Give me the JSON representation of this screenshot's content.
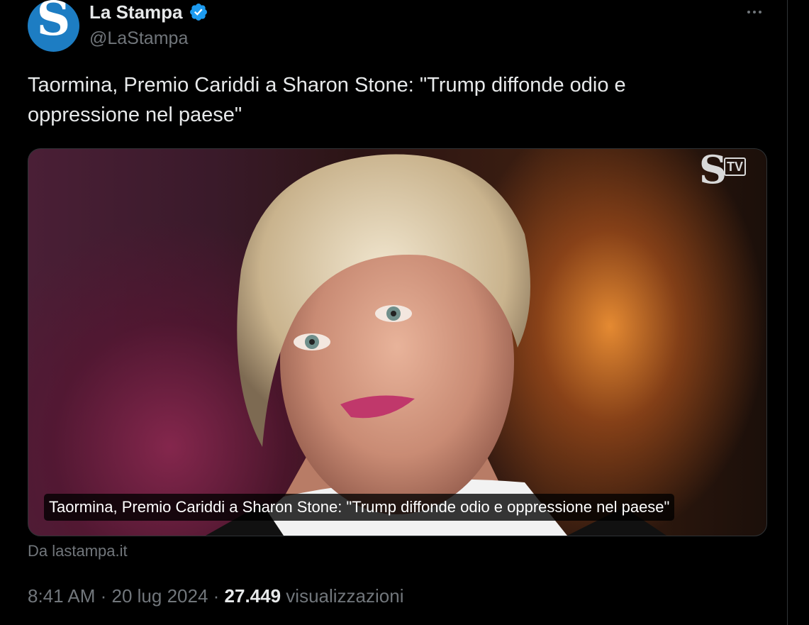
{
  "author": {
    "avatar_letter": "S",
    "display_name": "La Stampa",
    "handle": "@LaStampa",
    "verified": true,
    "verified_color": "#1d9bf0"
  },
  "tweet": {
    "text": "Taormina, Premio Cariddi a Sharon Stone: \"Trump diffonde odio e oppressione nel paese\""
  },
  "card": {
    "logo_s": "S",
    "logo_tv": "TV",
    "caption": "Taormina, Premio Cariddi a Sharon Stone: \"Trump diffonde odio e oppressione nel paese\"",
    "source": "Da lastampa.it"
  },
  "meta": {
    "time": "8:41 AM",
    "date": "20 lug 2024",
    "separator": " · ",
    "views_count": "27.449",
    "views_label": "visualizzazioni"
  },
  "colors": {
    "background": "#000000",
    "text_primary": "#e7e9ea",
    "text_secondary": "#71767b",
    "border": "#2f3336",
    "brand_blue": "#1d7dc3"
  },
  "icons": {
    "verified": "verified-badge-icon",
    "more": "more-horizontal-icon"
  }
}
